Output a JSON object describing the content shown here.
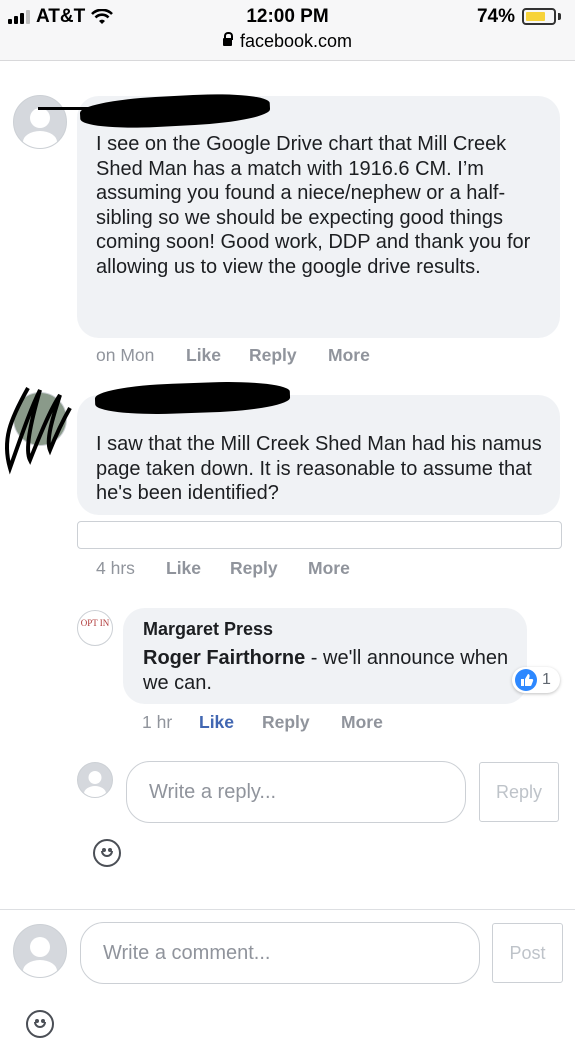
{
  "status_bar": {
    "carrier": "AT&T",
    "time": "12:00 PM",
    "url": "facebook.com",
    "battery": "74%",
    "battery_level": 0.74
  },
  "comments": [
    {
      "text": "I see on the Google Drive chart that Mill Creek Shed Man has a match with 1916.6 CM. I’m assuming you found a niece/nephew or a half-sibling so we should be expecting good things coming soon! Good work, DDP and thank you for allowing us to view the google drive results.",
      "time": "on Mon",
      "like": "Like",
      "reply": "Reply",
      "more": "More"
    },
    {
      "text": "I saw that the Mill Creek Shed Man had his namus page taken down. It is reasonable to assume that he's been identified?",
      "time": "4 hrs",
      "like": "Like",
      "reply": "Reply",
      "more": "More"
    }
  ],
  "reply": {
    "avatar_text": "OPT IN",
    "author": "Margaret Press",
    "mention": "Roger Fairthorne",
    "text": " - we'll announce when we can.",
    "reaction_count": "1",
    "time": "1 hr",
    "like": "Like",
    "reply": "Reply",
    "more": "More"
  },
  "reply_input": {
    "placeholder": "Write a reply...",
    "button": "Reply"
  },
  "comment_input": {
    "placeholder": "Write a comment...",
    "button": "Post"
  },
  "colors": {
    "link_blue": "#4267b2",
    "bubble": "#f0f2f5",
    "meta_gray": "#90949c"
  }
}
